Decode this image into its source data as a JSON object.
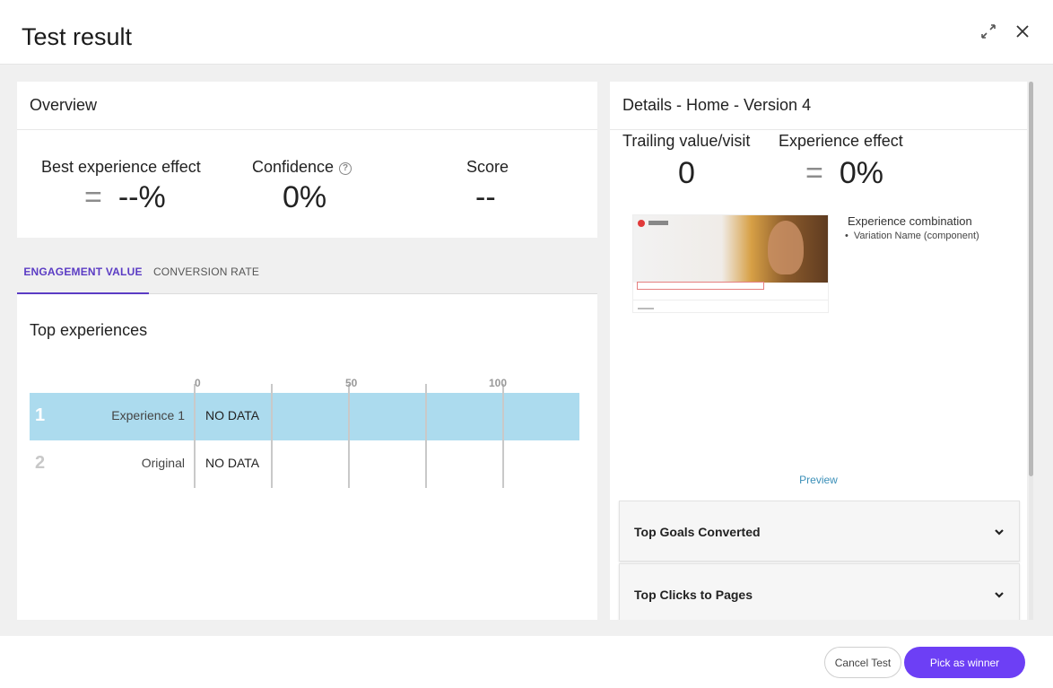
{
  "header": {
    "title": "Test result",
    "expand_icon": "expand-icon",
    "close_icon": "close-icon"
  },
  "overview": {
    "title": "Overview",
    "best_effect": {
      "label": "Best experience effect",
      "symbol": "=",
      "value": "--%"
    },
    "confidence": {
      "label": "Confidence",
      "value": "0%",
      "help_icon": "help-icon"
    },
    "score": {
      "label": "Score",
      "value": "--"
    }
  },
  "tabs": [
    {
      "label": "ENGAGEMENT VALUE",
      "active": true
    },
    {
      "label": "CONVERSION RATE",
      "active": false
    }
  ],
  "top_experiences": {
    "title": "Top experiences",
    "axis_ticks": [
      "0",
      "50",
      "100"
    ],
    "rows": [
      {
        "rank": "1",
        "name": "Experience 1",
        "value": "NO DATA",
        "highlighted": true
      },
      {
        "rank": "2",
        "name": "Original",
        "value": "NO DATA",
        "highlighted": false
      }
    ]
  },
  "details": {
    "title": "Details - Home - Version 4",
    "trailing": {
      "label": "Trailing value/visit",
      "value": "0"
    },
    "effect": {
      "label": "Experience effect",
      "symbol": "=",
      "value": "0%"
    },
    "combination": {
      "title": "Experience combination",
      "items": [
        "Variation Name (component)"
      ]
    },
    "preview_label": "Preview",
    "accordions": [
      {
        "label": "Top Goals Converted"
      },
      {
        "label": "Top Clicks to Pages"
      }
    ]
  },
  "footer": {
    "cancel_label": "Cancel Test",
    "winner_label": "Pick as winner"
  },
  "colors": {
    "accent": "#5b3cc4",
    "primary_button": "#6d3ff5",
    "highlight_row": "#acdbee",
    "link": "#3a8fb8"
  }
}
